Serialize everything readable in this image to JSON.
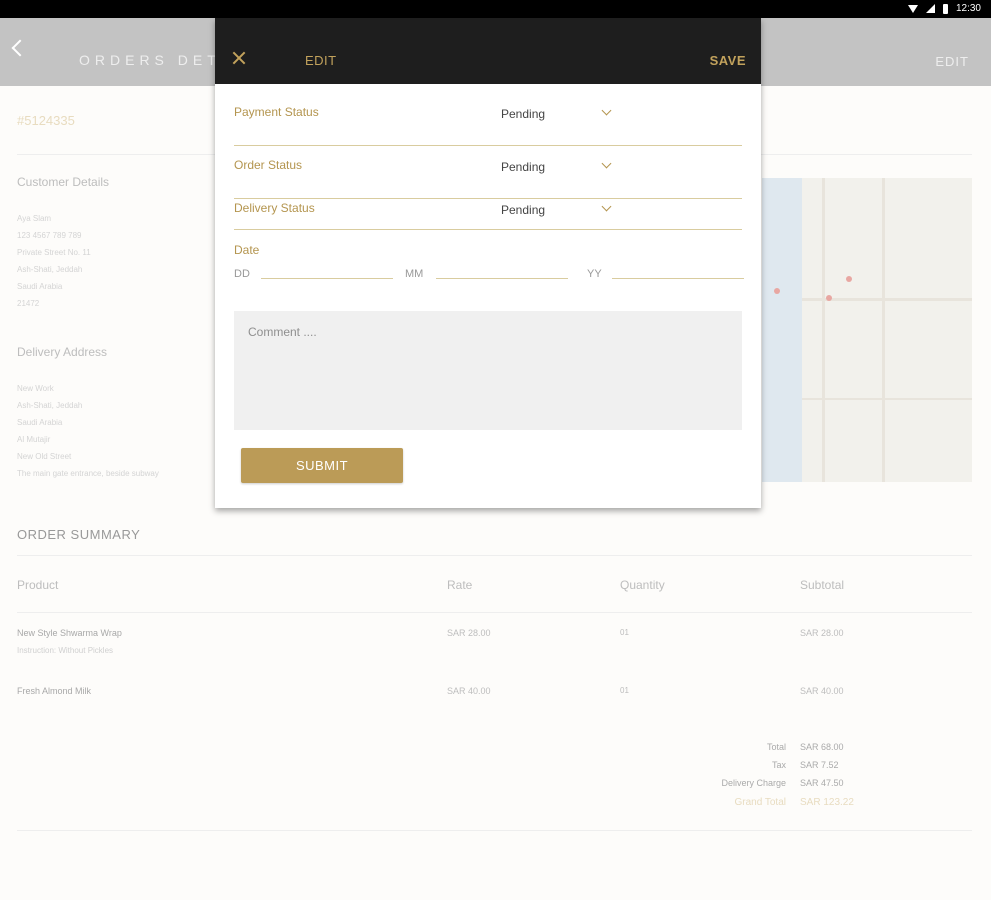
{
  "status_bar": {
    "time": "12:30"
  },
  "app_bar": {
    "title": "ORDERS DETAILS",
    "edit_label": "EDIT"
  },
  "order": {
    "number": "#5124335"
  },
  "customer": {
    "heading": "Customer Details",
    "lines": [
      "Aya Slam",
      "123 4567 789 789",
      "Private Street No. 11",
      "Ash-Shati, Jeddah",
      "Saudi Arabia",
      "21472"
    ]
  },
  "delivery": {
    "heading": "Delivery Address",
    "lines": [
      "New Work",
      "Ash-Shati, Jeddah",
      "Saudi Arabia",
      "Al Mutajir",
      "New Old Street",
      "The main gate entrance, beside subway"
    ]
  },
  "summary": {
    "heading": "ORDER SUMMARY",
    "columns": [
      "Product",
      "Rate",
      "Quantity",
      "Subtotal"
    ],
    "rows": [
      {
        "product": "New Style Shwarma Wrap",
        "note": "Instruction: Without Pickles",
        "rate": "SAR 28.00",
        "qty": "01",
        "subtotal": "SAR 28.00"
      },
      {
        "product": "Fresh Almond Milk",
        "note": "",
        "rate": "SAR 40.00",
        "qty": "01",
        "subtotal": "SAR 40.00"
      }
    ],
    "totals": [
      {
        "label": "Total",
        "value": "SAR 68.00"
      },
      {
        "label": "Tax",
        "value": "SAR 7.52"
      },
      {
        "label": "Delivery Charge",
        "value": "SAR 47.50"
      },
      {
        "label": "Grand Total",
        "value": "SAR 123.22"
      }
    ]
  },
  "dialog": {
    "title": "EDIT",
    "save_label": "SAVE",
    "payment_status": {
      "label": "Payment Status",
      "value": "Pending"
    },
    "order_status": {
      "label": "Order Status",
      "value": "Pending"
    },
    "delivery_status": {
      "label": "Delivery Status",
      "value": "Pending"
    },
    "date": {
      "label": "Date",
      "dd": "DD",
      "mm": "MM",
      "yy": "YY"
    },
    "comment_placeholder": "Comment ....",
    "submit_label": "SUBMIT"
  },
  "colors": {
    "accent": "#bb9b57",
    "header": "#1e1e1e",
    "appbar": "#c3c3c3"
  }
}
